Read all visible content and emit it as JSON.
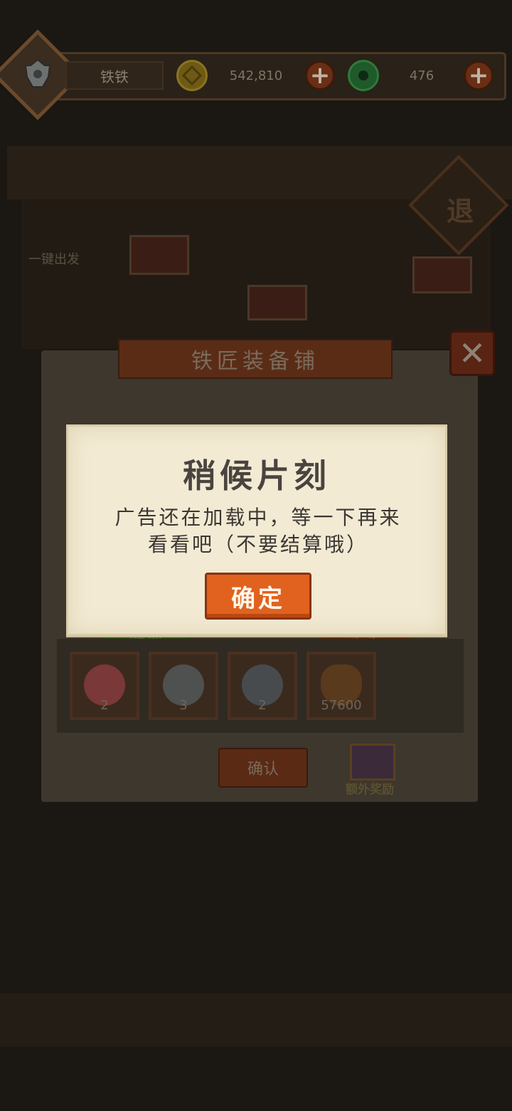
{
  "header": {
    "player_name": "铁铁",
    "gold_amount": "542,810",
    "jade_amount": "476",
    "plus_symbol": "+"
  },
  "scene": {
    "depart_label": "一键出发",
    "diamond_label": "退"
  },
  "shop": {
    "title": "铁匠装备铺",
    "close_symbol": "✕",
    "cancel_label": "取消",
    "watch_label": "看看",
    "items": [
      {
        "count": "2",
        "color": "#7a3838"
      },
      {
        "count": "3",
        "color": "#4e5150"
      },
      {
        "count": "2",
        "color": "#474b4e"
      },
      {
        "count": "57600",
        "color": "#5a3a1c"
      }
    ],
    "confirm_label": "确认",
    "bonus_label": "额外奖励"
  },
  "modal": {
    "title": "稍候片刻",
    "message_line1": "广告还在加载中，等一下再来",
    "message_line2": "看看吧（不要结算哦）",
    "ok_label": "确定"
  }
}
